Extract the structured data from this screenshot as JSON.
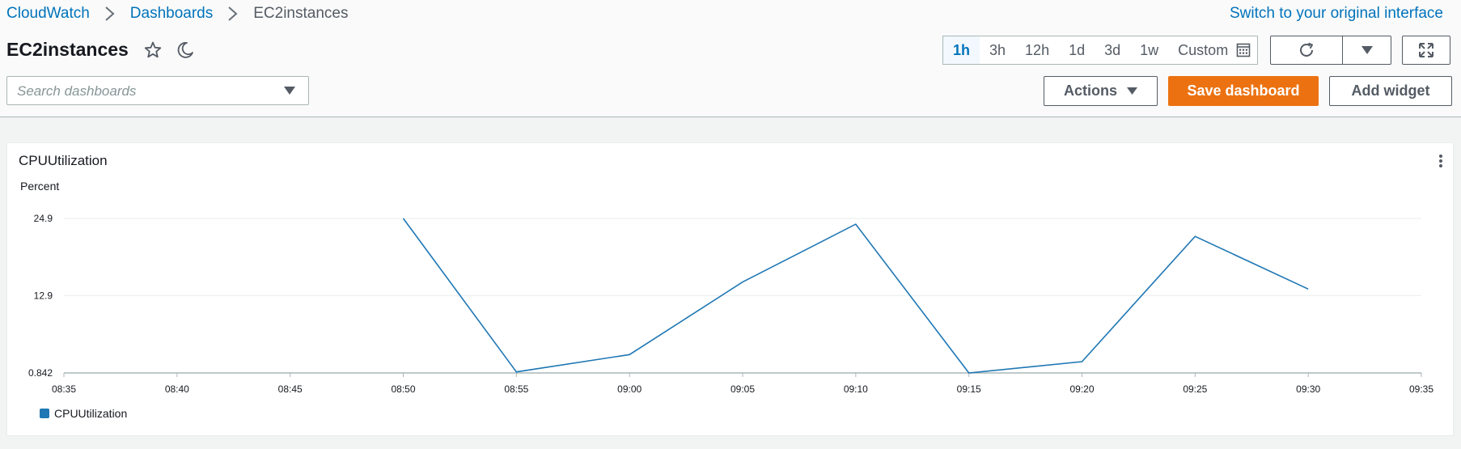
{
  "breadcrumb": {
    "items": [
      "CloudWatch",
      "Dashboards"
    ],
    "current": "EC2instances"
  },
  "switch_link": "Switch to your original interface",
  "page_title": "EC2instances",
  "title_icons": [
    "star-icon",
    "moon-icon"
  ],
  "time_range": {
    "options": [
      "1h",
      "3h",
      "12h",
      "1d",
      "3d",
      "1w"
    ],
    "custom": "Custom",
    "selected": "1h"
  },
  "search": {
    "placeholder": "Search dashboards",
    "value": ""
  },
  "buttons": {
    "actions": "Actions",
    "save": "Save dashboard",
    "add_widget": "Add widget"
  },
  "colors": {
    "primary": "#ec7211",
    "link": "#0073bb",
    "series": "#1f77b4"
  },
  "widget": {
    "title": "CPUUtilization"
  },
  "chart_data": {
    "type": "line",
    "ylabel": "Percent",
    "yticks": [
      "24.9",
      "12.9",
      "0.842"
    ],
    "ylim": [
      0.842,
      24.9
    ],
    "x": [
      "08:35",
      "08:40",
      "08:45",
      "08:50",
      "08:55",
      "09:00",
      "09:05",
      "09:10",
      "09:15",
      "09:20",
      "09:25",
      "09:30",
      "09:35"
    ],
    "series": [
      {
        "name": "CPUUtilization",
        "color": "#1f77b4",
        "points": [
          {
            "x": "08:50",
            "y": 24.9
          },
          {
            "x": "08:55",
            "y": 1.0
          },
          {
            "x": "09:00",
            "y": 3.7
          },
          {
            "x": "09:05",
            "y": 15.0
          },
          {
            "x": "09:10",
            "y": 24.0
          },
          {
            "x": "09:15",
            "y": 0.842
          },
          {
            "x": "09:20",
            "y": 2.6
          },
          {
            "x": "09:25",
            "y": 22.1
          },
          {
            "x": "09:30",
            "y": 13.9
          }
        ]
      }
    ],
    "legend": {
      "position": "bottom-left"
    },
    "grid": true
  }
}
